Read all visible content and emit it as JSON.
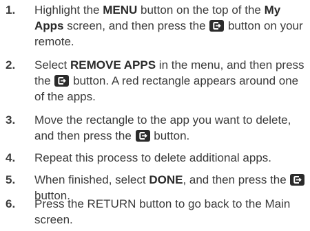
{
  "steps": [
    {
      "number": "1.",
      "parts": {
        "a": "Highlight the ",
        "b": "MENU",
        "c": " button on the top of the ",
        "d": "My Apps",
        "e": " screen, and then press the ",
        "f": " button on your remote."
      }
    },
    {
      "number": "2.",
      "parts": {
        "a": "Select ",
        "b": "REMOVE APPS",
        "c": " in the menu, and then press the ",
        "d": " button. A red rectangle appears around one of the apps."
      }
    },
    {
      "number": "3.",
      "parts": {
        "a": "Move the rectangle to the app you want to delete, and then press the ",
        "b": " button."
      }
    },
    {
      "number": "4.",
      "parts": {
        "a": "Repeat this process to delete additional apps."
      }
    },
    {
      "number": "5.",
      "parts": {
        "a": "When finished, select ",
        "b": "DONE",
        "c": ", and then press the ",
        "d": " button."
      }
    },
    {
      "number": "6.",
      "parts": {
        "a": "Press the ",
        "b": "RETURN",
        "c": " button to go back to the Main screen."
      }
    }
  ],
  "icons": {
    "enter": "enter-button-icon"
  }
}
